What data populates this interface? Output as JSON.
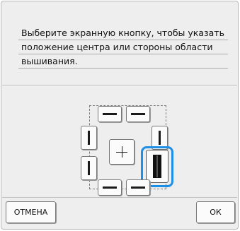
{
  "dialog": {
    "message_lines": [
      "Выберите экранную кнопку, чтобы указать",
      "положение центра или стороны области",
      "вышивания."
    ]
  },
  "buttons": {
    "cancel_label": "ОТМЕНА",
    "ok_label": "ОК"
  },
  "position_selector": {
    "selected": "right-lower",
    "accent_color": "#1e8fe6"
  }
}
